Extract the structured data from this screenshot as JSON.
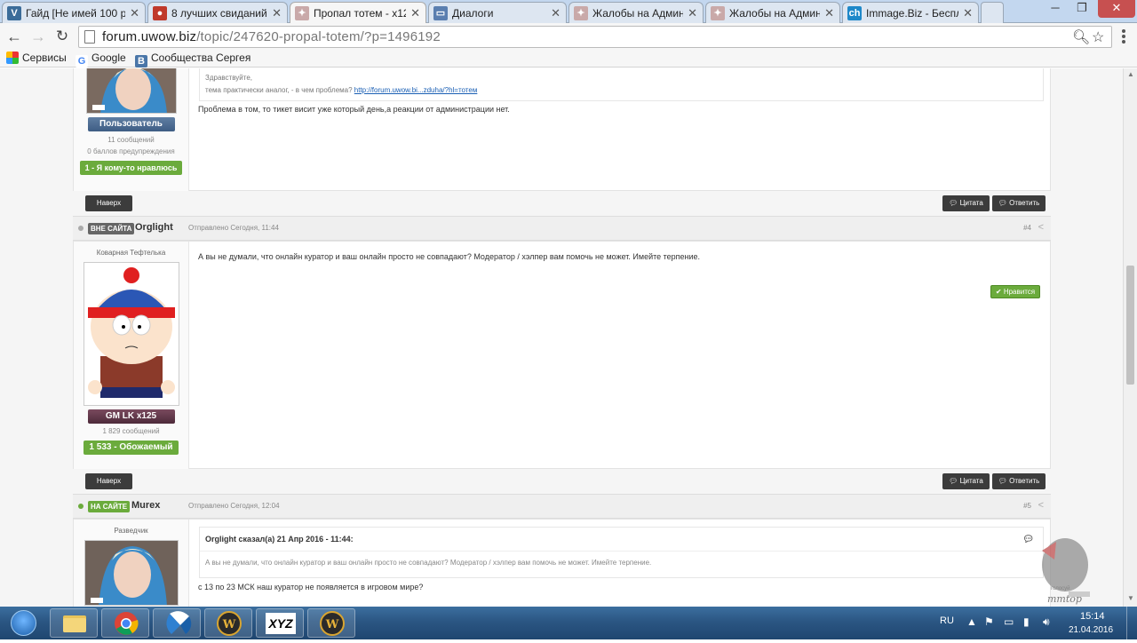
{
  "browser": {
    "tabs": [
      {
        "label": "Гайд [Не имей 100 р",
        "icon": "vk-like-icon",
        "color": "#3b6c99"
      },
      {
        "label": "8 лучших свиданий в",
        "icon": "speech-bubble-icon",
        "color": "#c0392b"
      },
      {
        "label": "Пропал тотем - x125",
        "icon": "forum-icon",
        "color": "#8b5a5a",
        "active": true
      },
      {
        "label": "Диалоги",
        "icon": "messages-icon",
        "color": "#5b7fb0"
      },
      {
        "label": "Жалобы на Админи",
        "icon": "forum-icon",
        "color": "#8b5a5a"
      },
      {
        "label": "Жалобы на Админи",
        "icon": "forum-icon",
        "color": "#8b5a5a"
      },
      {
        "label": "Immage.Biz - Беспла",
        "icon": "immage-icon",
        "color": "#1e88c9"
      }
    ],
    "url_host": "forum.uwow.biz",
    "url_path": "/topic/247620-propal-totem/?p=1496192",
    "bookmarks": [
      {
        "label": "Сервисы"
      },
      {
        "label": "Google"
      },
      {
        "label": "Сообщества Сергея"
      }
    ]
  },
  "posts": {
    "p3": {
      "quote_greeting": "Здравствуйте,",
      "quote_text": "тема практически аналог, - в чем проблема?",
      "quote_link": "http://forum.uwow.bi...zduha/?hl=тотем",
      "text": "Проблема в том, то тикет висит уже который день,а реакции от администрации нет.",
      "group": "Пользователь",
      "post_count": "11 сообщений",
      "warnings": "0 баллов предупреждения",
      "reputation": "1 - Я кому-то нравлюсь"
    },
    "p4": {
      "status": "ВНЕ САЙТА",
      "author": "Orglight",
      "date": "Отправлено Сегодня, 11:44",
      "number": "#4",
      "rank": "Коварная Тефтелька",
      "text": "А вы не думали, что онлайн куратор и ваш онлайн просто не совпадают? Модератор / хэлпер вам помочь не может. Имейте терпение.",
      "like": "Нравится",
      "group": "GM LK x125",
      "post_count": "1 829 сообщений",
      "reputation": "1 533 - Обожаемый"
    },
    "p5": {
      "status": "НА САЙТЕ",
      "author": "Murex",
      "date": "Отправлено Сегодня, 12:04",
      "number": "#5",
      "rank": "Разведчик",
      "quote_author": "Orglight сказал(а) 21 Апр 2016 - 11:44:",
      "quote_text": "А вы не думали, что онлайн куратор и ваш онлайн просто не совпадают? Модератор / хэлпер вам помочь не может. Имейте терпение.",
      "text": "с 13 по 23 МСК наш куратор не появляется в игровом мире?"
    }
  },
  "actions": {
    "top": "Наверх",
    "quote": "Цитата",
    "reply": "Ответить"
  },
  "watermark": {
    "line1": "голосуй",
    "line2": "mmtop"
  },
  "taskbar": {
    "apps": [
      "explorer",
      "chrome",
      "edge-k",
      "wow",
      "xyz",
      "wow2"
    ],
    "xyz_label": "XYZ",
    "lang": "RU",
    "time": "15:14",
    "date": "21.04.2016"
  }
}
